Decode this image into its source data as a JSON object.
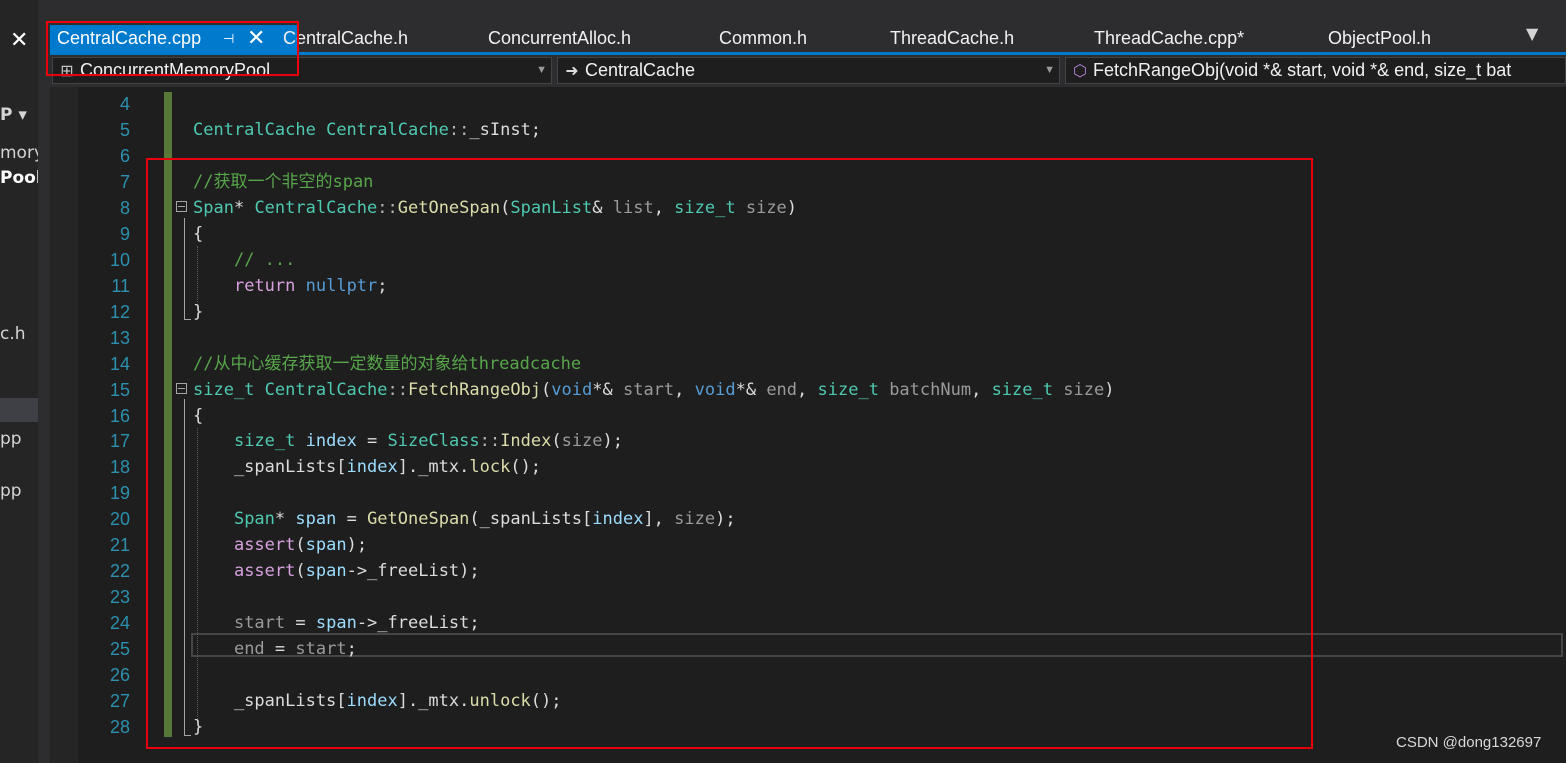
{
  "left_panel": {
    "close_glyph": "✕",
    "items": [
      "P ▾",
      "mory",
      "Pool",
      "c.h",
      "pp",
      "pp"
    ]
  },
  "tabs": [
    {
      "label": "CentralCache.cpp",
      "active": true
    },
    {
      "label": "CentralCache.h"
    },
    {
      "label": "ConcurrentAlloc.h"
    },
    {
      "label": "Common.h"
    },
    {
      "label": "ThreadCache.h"
    },
    {
      "label": "ThreadCache.cpp*"
    },
    {
      "label": "ObjectPool.h"
    }
  ],
  "tab_controls": {
    "pin_glyph": "⊣",
    "close_glyph": "✕",
    "overflow_glyph": "▼"
  },
  "navbar": {
    "project": "ConcurrentMemoryPool",
    "scope": "CentralCache",
    "member": "FetchRangeObj(void *& start, void *& end, size_t bat"
  },
  "code_lines": [
    {
      "n": "4",
      "tokens": []
    },
    {
      "n": "5",
      "tokens": [
        [
          "cls",
          "CentralCache"
        ],
        [
          "txt",
          " "
        ],
        [
          "cls",
          "CentralCache"
        ],
        [
          "op",
          "::"
        ],
        [
          "txt",
          "_sInst;"
        ]
      ]
    },
    {
      "n": "6",
      "tokens": []
    },
    {
      "n": "7",
      "tokens": [
        [
          "com",
          "//获取一个非空的span"
        ]
      ]
    },
    {
      "n": "8",
      "tokens": [
        [
          "cls",
          "Span"
        ],
        [
          "txt",
          "* "
        ],
        [
          "cls",
          "CentralCache"
        ],
        [
          "op",
          "::"
        ],
        [
          "fn",
          "GetOneSpan"
        ],
        [
          "txt",
          "("
        ],
        [
          "cls",
          "SpanList"
        ],
        [
          "txt",
          "& "
        ],
        [
          "par",
          "list"
        ],
        [
          "txt",
          ", "
        ],
        [
          "cls",
          "size_t"
        ],
        [
          "txt",
          " "
        ],
        [
          "par",
          "size"
        ],
        [
          "txt",
          ")"
        ]
      ]
    },
    {
      "n": "9",
      "tokens": [
        [
          "txt",
          "{"
        ]
      ]
    },
    {
      "n": "10",
      "tokens": [
        [
          "txt",
          "    "
        ],
        [
          "com",
          "// ..."
        ]
      ]
    },
    {
      "n": "11",
      "tokens": [
        [
          "txt",
          "    "
        ],
        [
          "kw2",
          "return"
        ],
        [
          "txt",
          " "
        ],
        [
          "kw",
          "nullptr"
        ],
        [
          "txt",
          ";"
        ]
      ]
    },
    {
      "n": "12",
      "tokens": [
        [
          "txt",
          "}"
        ]
      ]
    },
    {
      "n": "13",
      "tokens": []
    },
    {
      "n": "14",
      "tokens": [
        [
          "com",
          "//从中心缓存获取一定数量的对象给threadcache"
        ]
      ]
    },
    {
      "n": "15",
      "tokens": [
        [
          "cls",
          "size_t"
        ],
        [
          "txt",
          " "
        ],
        [
          "cls",
          "CentralCache"
        ],
        [
          "op",
          "::"
        ],
        [
          "fn",
          "FetchRangeObj"
        ],
        [
          "txt",
          "("
        ],
        [
          "kw",
          "void"
        ],
        [
          "txt",
          "*& "
        ],
        [
          "par",
          "start"
        ],
        [
          "txt",
          ", "
        ],
        [
          "kw",
          "void"
        ],
        [
          "txt",
          "*& "
        ],
        [
          "par",
          "end"
        ],
        [
          "txt",
          ", "
        ],
        [
          "cls",
          "size_t"
        ],
        [
          "txt",
          " "
        ],
        [
          "par",
          "batchNum"
        ],
        [
          "txt",
          ", "
        ],
        [
          "cls",
          "size_t"
        ],
        [
          "txt",
          " "
        ],
        [
          "par",
          "size"
        ],
        [
          "txt",
          ")"
        ]
      ]
    },
    {
      "n": "16",
      "tokens": [
        [
          "txt",
          "{"
        ]
      ]
    },
    {
      "n": "17",
      "tokens": [
        [
          "txt",
          "    "
        ],
        [
          "cls",
          "size_t"
        ],
        [
          "txt",
          " "
        ],
        [
          "var",
          "index"
        ],
        [
          "txt",
          " = "
        ],
        [
          "cls",
          "SizeClass"
        ],
        [
          "op",
          "::"
        ],
        [
          "fn",
          "Index"
        ],
        [
          "txt",
          "("
        ],
        [
          "par",
          "size"
        ],
        [
          "txt",
          ");"
        ]
      ]
    },
    {
      "n": "18",
      "tokens": [
        [
          "txt",
          "    _spanLists["
        ],
        [
          "var",
          "index"
        ],
        [
          "txt",
          "]._mtx."
        ],
        [
          "fn",
          "lock"
        ],
        [
          "txt",
          "();"
        ]
      ]
    },
    {
      "n": "19",
      "tokens": []
    },
    {
      "n": "20",
      "tokens": [
        [
          "txt",
          "    "
        ],
        [
          "cls",
          "Span"
        ],
        [
          "txt",
          "* "
        ],
        [
          "var",
          "span"
        ],
        [
          "txt",
          " = "
        ],
        [
          "fn",
          "GetOneSpan"
        ],
        [
          "txt",
          "(_spanLists["
        ],
        [
          "var",
          "index"
        ],
        [
          "txt",
          "], "
        ],
        [
          "par",
          "size"
        ],
        [
          "txt",
          ");"
        ]
      ]
    },
    {
      "n": "21",
      "tokens": [
        [
          "txt",
          "    "
        ],
        [
          "kw2",
          "assert"
        ],
        [
          "txt",
          "("
        ],
        [
          "var",
          "span"
        ],
        [
          "txt",
          ");"
        ]
      ]
    },
    {
      "n": "22",
      "tokens": [
        [
          "txt",
          "    "
        ],
        [
          "kw2",
          "assert"
        ],
        [
          "txt",
          "("
        ],
        [
          "var",
          "span"
        ],
        [
          "txt",
          "->_freeList);"
        ]
      ]
    },
    {
      "n": "23",
      "tokens": []
    },
    {
      "n": "24",
      "tokens": [
        [
          "txt",
          "    "
        ],
        [
          "par",
          "start"
        ],
        [
          "txt",
          " = "
        ],
        [
          "var",
          "span"
        ],
        [
          "txt",
          "->_freeList;"
        ]
      ]
    },
    {
      "n": "25",
      "tokens": [
        [
          "txt",
          "    "
        ],
        [
          "par",
          "end"
        ],
        [
          "txt",
          " = "
        ],
        [
          "par",
          "start"
        ],
        [
          "txt",
          ";"
        ]
      ]
    },
    {
      "n": "26",
      "tokens": []
    },
    {
      "n": "27",
      "tokens": [
        [
          "txt",
          "    _spanLists["
        ],
        [
          "var",
          "index"
        ],
        [
          "txt",
          "]._mtx."
        ],
        [
          "fn",
          "unlock"
        ],
        [
          "txt",
          "();"
        ]
      ]
    },
    {
      "n": "28",
      "tokens": [
        [
          "txt",
          "}"
        ]
      ]
    }
  ],
  "watermark": "CSDN @dong132697"
}
